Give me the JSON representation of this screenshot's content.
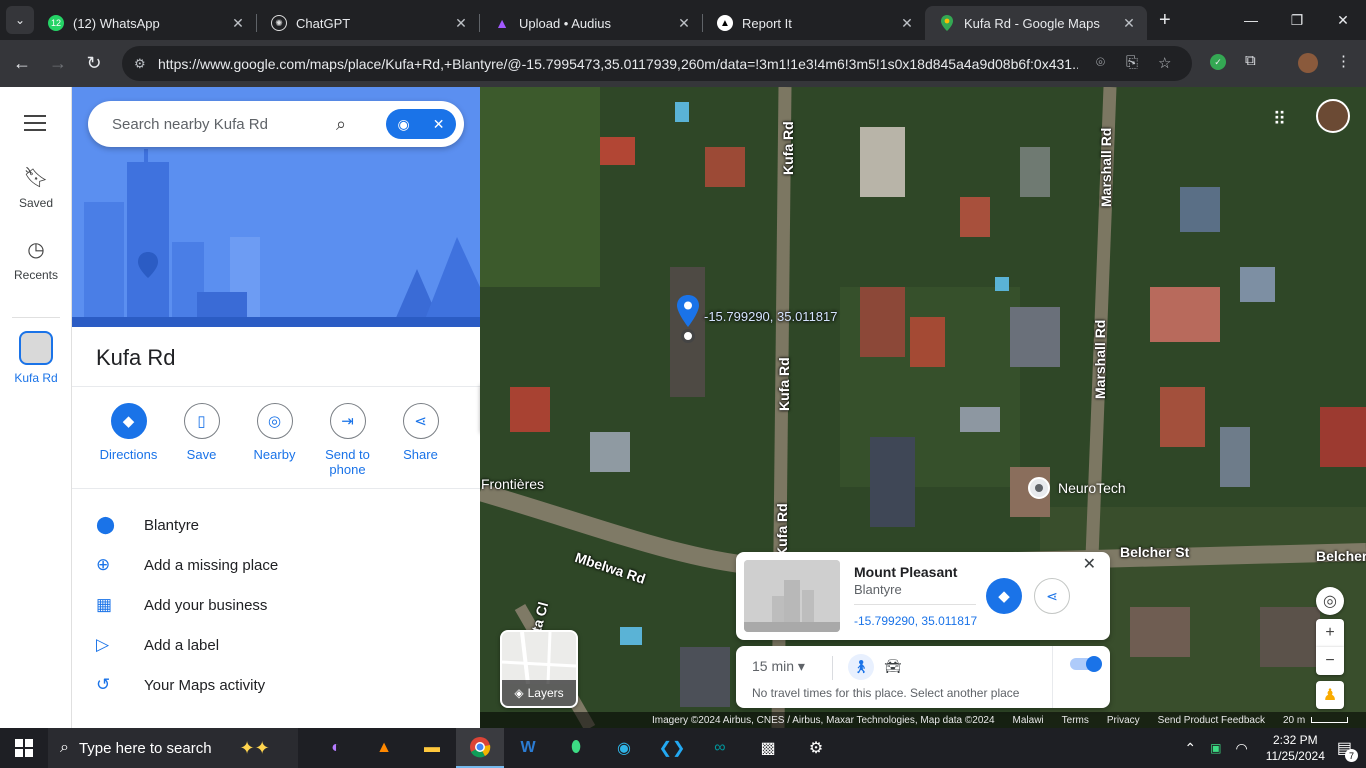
{
  "browser": {
    "tabs": [
      {
        "title": "(12) WhatsApp",
        "icon": "whatsapp-icon",
        "badge": "12",
        "color": "#25d366"
      },
      {
        "title": "ChatGPT",
        "icon": "chatgpt-icon",
        "color": "#ffffff"
      },
      {
        "title": "Upload • Audius",
        "icon": "audius-icon",
        "color": "#a259ff"
      },
      {
        "title": "Report It",
        "icon": "report-it-icon",
        "color": "#ffffff"
      },
      {
        "title": "Kufa Rd - Google Maps",
        "icon": "google-maps-icon",
        "color": "#34a853"
      }
    ],
    "url": "https://www.google.com/maps/place/Kufa+Rd,+Blantyre/@-15.7995473,35.0117939,260m/data=!3m1!1e3!4m6!3m5!1s0x18d845a4a9d08b6f:0x431..."
  },
  "rail": {
    "saved": "Saved",
    "recents": "Recents",
    "current": "Kufa Rd"
  },
  "panel": {
    "search_placeholder": "Search nearby Kufa Rd",
    "title": "Kufa Rd",
    "actions": {
      "directions": "Directions",
      "save": "Save",
      "nearby": "Nearby",
      "send_to_phone": "Send to phone",
      "share": "Share"
    },
    "list": {
      "city": "Blantyre",
      "add_missing_place": "Add a missing place",
      "add_business": "Add your business",
      "add_label": "Add a label",
      "maps_activity": "Your Maps activity"
    }
  },
  "map": {
    "road_labels": {
      "kufa_1": "Kufa Rd",
      "kufa_2": "Kufa Rd",
      "kufa_3": "Kufa Rd",
      "marshall_1": "Marshall Rd",
      "marshall_2": "Marshall Rd",
      "mbelwa": "Mbelwa Rd",
      "belcher_1": "Belcher St",
      "belcher_2": "Belcher",
      "frontieres": "Frontières",
      "beta_cl": "eta Cl"
    },
    "pin_coordinates": "-15.799290, 35.011817",
    "neurotech": "NeuroTech",
    "card": {
      "name": "Mount Pleasant",
      "sub": "Blantyre",
      "coords": "-15.799290, 35.011817"
    },
    "travel": {
      "duration": "15 min",
      "message": "No travel times for this place. Select another place"
    },
    "layers_label": "Layers",
    "attribution": {
      "imagery": "Imagery ©2024 Airbus, CNES / Airbus, Maxar Technologies, Map data ©2024",
      "country": "Malawi",
      "terms": "Terms",
      "privacy": "Privacy",
      "feedback": "Send Product Feedback",
      "scale": "20 m"
    }
  },
  "taskbar": {
    "search_placeholder": "Type here to search",
    "time": "2:32 PM",
    "date": "11/25/2024",
    "notifications": "7"
  }
}
